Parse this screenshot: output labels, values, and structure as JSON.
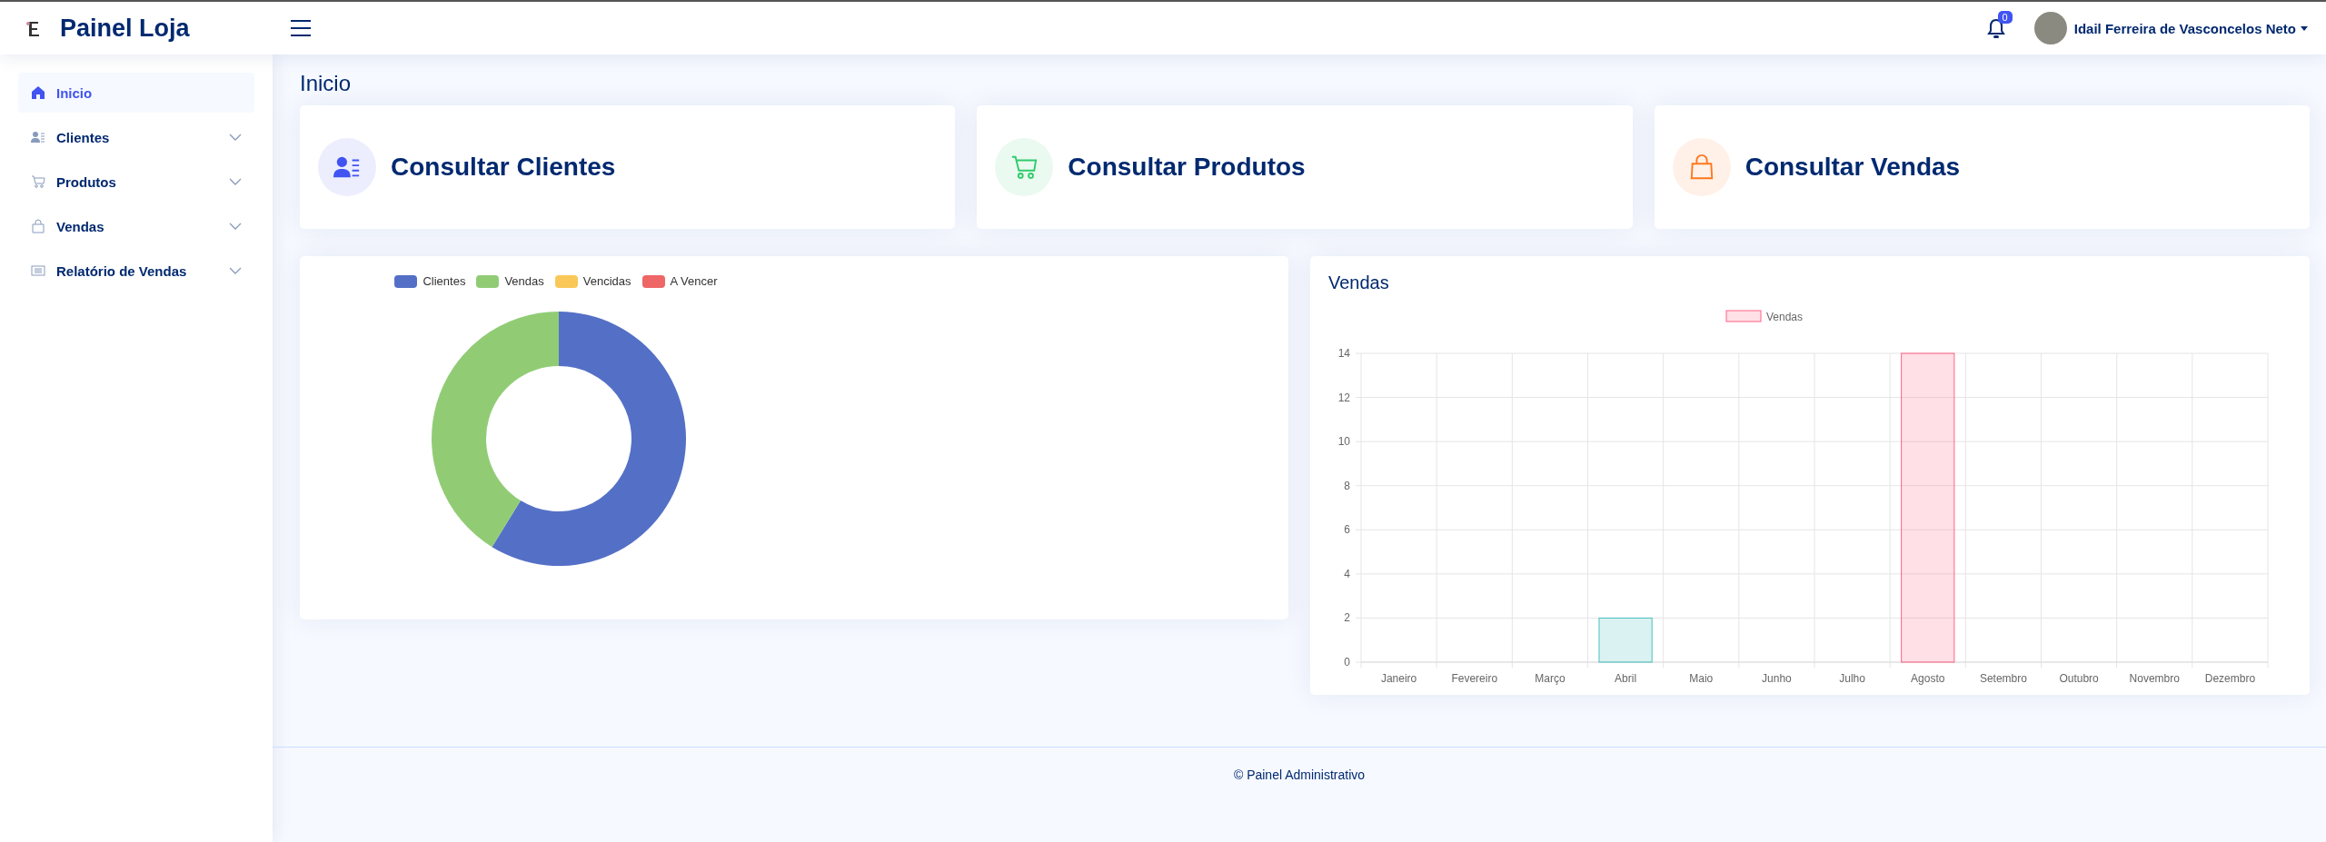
{
  "header": {
    "brand": "Painel Loja",
    "notifications": {
      "count": "0"
    },
    "user": {
      "name": "Idail Ferreira de Vasconcelos Neto"
    }
  },
  "sidebar": {
    "items": [
      {
        "label": "Inicio",
        "selected": true,
        "has_submenu": false
      },
      {
        "label": "Clientes",
        "selected": false,
        "has_submenu": true
      },
      {
        "label": "Produtos",
        "selected": false,
        "has_submenu": true
      },
      {
        "label": "Vendas",
        "selected": false,
        "has_submenu": true
      },
      {
        "label": "Relatório de Vendas",
        "selected": false,
        "has_submenu": true
      }
    ]
  },
  "page_title": "Inicio",
  "cards": [
    {
      "label": "Consultar Clientes",
      "color": "#4154f1"
    },
    {
      "label": "Consultar Produtos",
      "color": "#2eca6a"
    },
    {
      "label": "Consultar Vendas",
      "color": "#ff771d"
    }
  ],
  "donut_panel": {
    "legend": [
      {
        "label": "Clientes",
        "color": "#5470c6"
      },
      {
        "label": "Vendas",
        "color": "#91cc75"
      },
      {
        "label": "Vencidas",
        "color": "#fac858"
      },
      {
        "label": "A Vencer",
        "color": "#ee6666"
      }
    ]
  },
  "sales_panel": {
    "title": "Vendas",
    "chart_data": {
      "type": "bar",
      "categories": [
        "Janeiro",
        "Fevereiro",
        "Março",
        "Abril",
        "Maio",
        "Junho",
        "Julho",
        "Agosto",
        "Setembro",
        "Outubro",
        "Novembro",
        "Dezembro"
      ],
      "series": [
        {
          "name": "Vendas",
          "color": "#ff6384",
          "values": [
            0,
            0,
            0,
            2,
            0,
            0,
            0,
            14,
            0,
            0,
            0,
            0
          ],
          "colors": [
            null,
            null,
            null,
            "#4bc0c0",
            null,
            null,
            null,
            "#ff6384",
            null,
            null,
            null,
            null
          ]
        }
      ],
      "grid": true,
      "ylim": [
        0,
        14
      ],
      "yticks": [
        0,
        2,
        4,
        6,
        8,
        10,
        12,
        14
      ]
    }
  },
  "footer": "© Painel Administrativo"
}
